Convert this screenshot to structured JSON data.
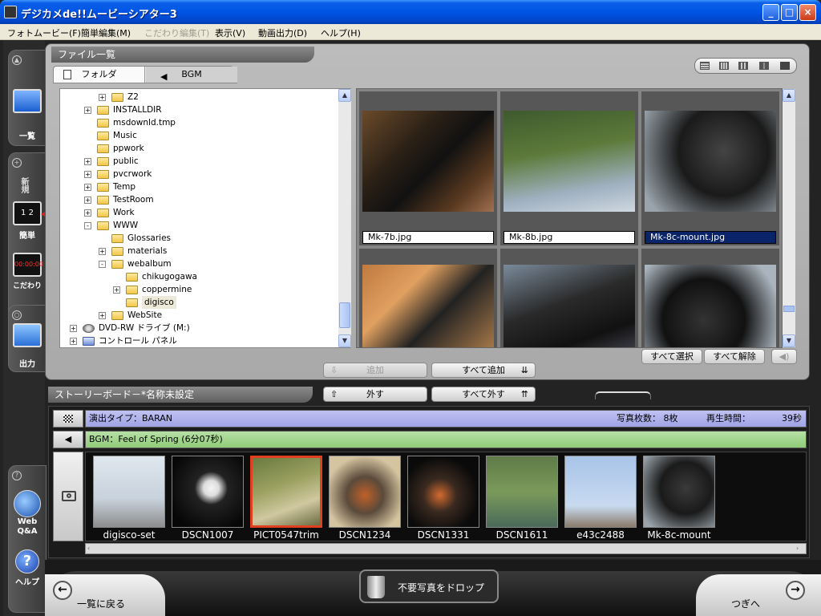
{
  "window": {
    "title": "デジカメde!!ムービーシアター3",
    "buttons": [
      "_",
      "□",
      "×"
    ]
  },
  "menu": [
    {
      "label": "フォトムービー(F)",
      "disabled": false
    },
    {
      "label": "簡単編集(M)",
      "disabled": false
    },
    {
      "label": "こだわり編集(T)",
      "disabled": true
    },
    {
      "label": "表示(V)",
      "disabled": false
    },
    {
      "label": "動画出力(D)",
      "disabled": false
    },
    {
      "label": "ヘルプ(H)",
      "disabled": false
    }
  ],
  "sidebar": {
    "list_label": "一覧",
    "new_label": "新規",
    "simple_label": "簡単",
    "detail_label": "こだわり",
    "output_label": "出力",
    "web_label": "Web\nQ&A",
    "help_label": "ヘルプ",
    "badge": "1 2",
    "clapper_time": "00:00:00"
  },
  "files": {
    "panel_title": "ファイル一覧",
    "tab_folder": "フォルダ",
    "tab_bgm": "BGM",
    "tree": [
      {
        "label": "Z2",
        "depth": 2,
        "expander": "+"
      },
      {
        "label": "INSTALLDIR",
        "depth": 1,
        "expander": "+"
      },
      {
        "label": "msdownld.tmp",
        "depth": 1,
        "expander": ""
      },
      {
        "label": "Music",
        "depth": 1,
        "expander": ""
      },
      {
        "label": "ppwork",
        "depth": 1,
        "expander": ""
      },
      {
        "label": "public",
        "depth": 1,
        "expander": "+"
      },
      {
        "label": "pvcrwork",
        "depth": 1,
        "expander": "+"
      },
      {
        "label": "Temp",
        "depth": 1,
        "expander": "+"
      },
      {
        "label": "TestRoom",
        "depth": 1,
        "expander": "+"
      },
      {
        "label": "Work",
        "depth": 1,
        "expander": "+"
      },
      {
        "label": "WWW",
        "depth": 1,
        "expander": "-"
      },
      {
        "label": "Glossaries",
        "depth": 2,
        "expander": ""
      },
      {
        "label": "materials",
        "depth": 2,
        "expander": "+"
      },
      {
        "label": "webalbum",
        "depth": 2,
        "expander": "-"
      },
      {
        "label": "chikugogawa",
        "depth": 3,
        "expander": ""
      },
      {
        "label": "coppermine",
        "depth": 3,
        "expander": "+"
      },
      {
        "label": "digisco",
        "depth": 3,
        "expander": "",
        "selected": true
      },
      {
        "label": "WebSite",
        "depth": 2,
        "expander": "+"
      },
      {
        "label": "DVD-RW ドライブ (M:)",
        "depth": 0,
        "expander": "+",
        "icon": "drive"
      },
      {
        "label": "コントロール パネル",
        "depth": 0,
        "expander": "+",
        "icon": "control"
      }
    ],
    "thumbs": [
      {
        "name": "Mk-7b.jpg",
        "selected": false
      },
      {
        "name": "Mk-8b.jpg",
        "selected": false
      },
      {
        "name": "Mk-8c-mount.jpg",
        "selected": true
      },
      {
        "name": "",
        "selected": false
      },
      {
        "name": "",
        "selected": false
      },
      {
        "name": "",
        "selected": false
      }
    ],
    "select_all": "すべて選択",
    "deselect_all": "すべて解除"
  },
  "actions": {
    "add": "追加",
    "add_all": "すべて追加",
    "remove": "外す",
    "remove_all": "すべて外す"
  },
  "storyboard": {
    "title": "ストーリーボード－*名称未設定",
    "effect": "演出タイプ：BARAN",
    "photo_count": "写真枚数：  8枚",
    "play_time_label": "再生時間：",
    "play_time": "39秒",
    "bgm": "BGM：Feel of Spring (6分07秒)",
    "items": [
      {
        "name": "digisco-set",
        "selected": false
      },
      {
        "name": "DSCN1007",
        "selected": false
      },
      {
        "name": "PICT0547trim",
        "selected": true
      },
      {
        "name": "DSCN1234",
        "selected": false
      },
      {
        "name": "DSCN1331",
        "selected": false
      },
      {
        "name": "DSCN1611",
        "selected": false
      },
      {
        "name": "e43c2488",
        "selected": false
      },
      {
        "name": "Mk-8c-mount",
        "selected": false
      }
    ]
  },
  "footer": {
    "back": "一覧に戻る",
    "drop": "不要写真をドロップ",
    "next": "つぎへ"
  }
}
